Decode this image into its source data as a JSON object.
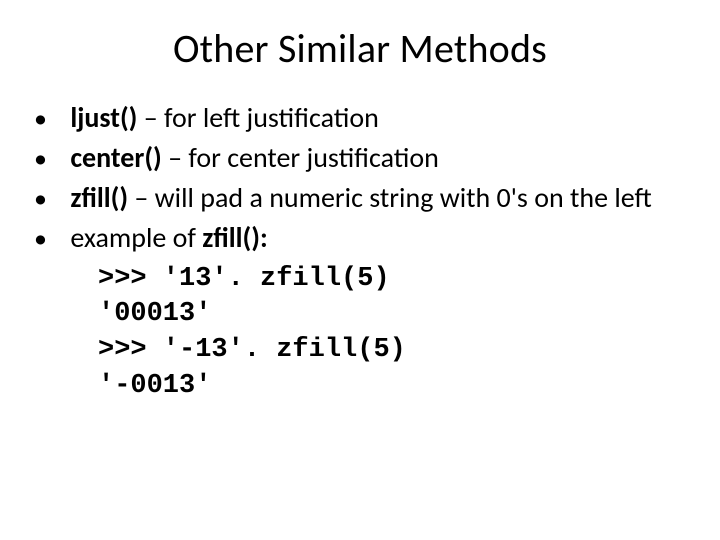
{
  "title": "Other Similar Methods",
  "bullets": [
    {
      "bold": "ljust()",
      "rest": " – for left justification"
    },
    {
      "bold": "center()",
      "rest": " – for center justification"
    },
    {
      "bold": "zfill()",
      "rest": " – will pad a numeric string with 0's on the left"
    },
    {
      "bold_prefix": "example of ",
      "bold": "zfill():",
      "rest": ""
    }
  ],
  "code": [
    ">>> '13'. zfill(5)",
    "'00013'",
    ">>> '-13'. zfill(5)",
    "'-0013'"
  ]
}
